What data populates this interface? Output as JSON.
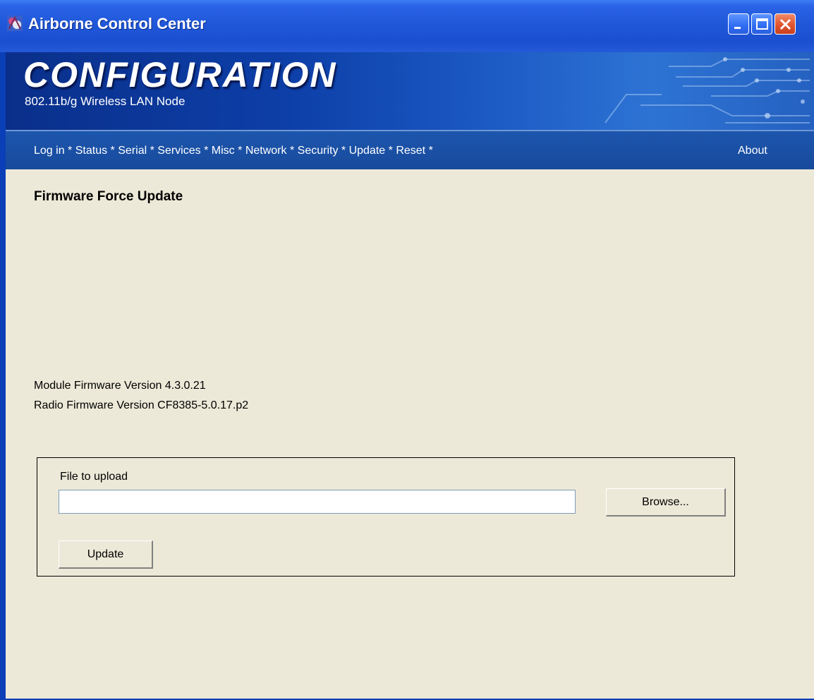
{
  "window": {
    "title": "Airborne Control Center",
    "controls": [
      "minimize",
      "maximize",
      "close"
    ]
  },
  "header": {
    "title": "CONFIGURATION",
    "subtitle": "802.11b/g Wireless LAN Node"
  },
  "nav": {
    "items": [
      {
        "label": "Log in",
        "sep": "*"
      },
      {
        "label": "Status",
        "sep": "*"
      },
      {
        "label": "Serial",
        "sep": "*"
      },
      {
        "label": "Services",
        "sep": "*"
      },
      {
        "label": "Misc",
        "sep": "*"
      },
      {
        "label": "Network",
        "sep": "*"
      },
      {
        "label": "Security",
        "sep": "*"
      },
      {
        "label": "Update",
        "sep": "*"
      },
      {
        "label": "Reset",
        "sep": "*"
      }
    ],
    "about": "About"
  },
  "page": {
    "title": "Firmware Force Update",
    "module_firmware": "Module Firmware Version 4.3.0.21",
    "radio_firmware": "Radio Firmware Version CF8385-5.0.17.p2"
  },
  "upload": {
    "label": "File to upload",
    "value": "",
    "browse_label": "Browse...",
    "update_label": "Update"
  },
  "colors": {
    "titlebar": "#1f56d8",
    "nav": "#1d56ad",
    "content_bg": "#ece9d8",
    "close_button": "#e0542e"
  }
}
